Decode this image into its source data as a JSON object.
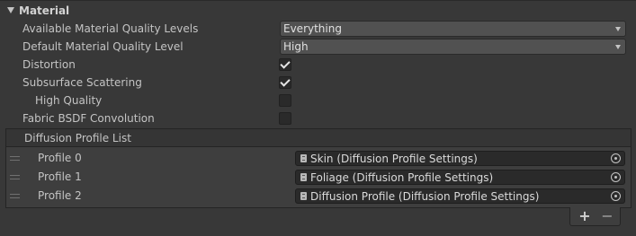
{
  "section": {
    "title": "Material"
  },
  "rows": [
    {
      "label": "Available Material Quality Levels",
      "value": "Everything"
    },
    {
      "label": "Default Material Quality Level",
      "value": "High"
    },
    {
      "label": "Distortion",
      "checked": true
    },
    {
      "label": "Subsurface Scattering",
      "checked": true
    },
    {
      "label": "High Quality",
      "checked": false
    },
    {
      "label": "Fabric BSDF Convolution",
      "checked": false
    }
  ],
  "diffusion_list": {
    "header": "Diffusion Profile List",
    "items": [
      {
        "label": "Profile 0",
        "value": "Skin (Diffusion Profile Settings)"
      },
      {
        "label": "Profile 1",
        "value": "Foliage (Diffusion Profile Settings)"
      },
      {
        "label": "Profile 2",
        "value": "Diffusion Profile (Diffusion Profile Settings)"
      }
    ],
    "add_label": "+",
    "remove_label": "−"
  },
  "icons": {
    "foldout": "triangle-down-icon",
    "drag": "drag-handle-icon",
    "object": "scriptable-object-icon",
    "picker": "object-picker-icon"
  }
}
